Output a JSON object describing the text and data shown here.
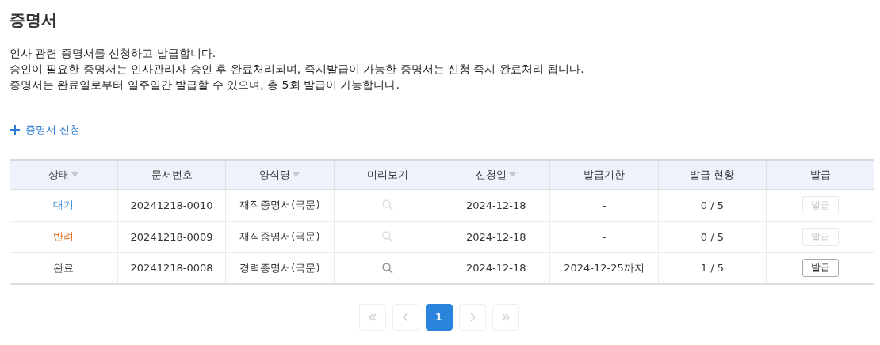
{
  "page_title": "증명서",
  "description": [
    "인사 관련 증명서를 신청하고 발급합니다.",
    "승인이 필요한 증명서는 인사관리자 승인 후 완료처리되며, 즉시발급이 가능한 증명서는 신청 즉시 완료처리 됩니다.",
    "증명서는 완료일로부터 일주일간 발급할 수 있으며, 총 5회 발급이 가능합니다."
  ],
  "request_link": {
    "label": "증명서 신청"
  },
  "table": {
    "columns": [
      {
        "label": "상태",
        "sortable": true
      },
      {
        "label": "문서번호",
        "sortable": false
      },
      {
        "label": "양식명",
        "sortable": true
      },
      {
        "label": "미리보기",
        "sortable": false
      },
      {
        "label": "신청일",
        "sortable": true
      },
      {
        "label": "발급기한",
        "sortable": false
      },
      {
        "label": "발급 현황",
        "sortable": false
      },
      {
        "label": "발급",
        "sortable": false
      }
    ],
    "rows": [
      {
        "status": "대기",
        "color": "#3d8fd9",
        "doc_no": "20241218-0010",
        "form": "재직증명서(국문)",
        "preview_enabled": false,
        "date": "2024-12-18",
        "deadline": "-",
        "count": "0 / 5",
        "issue": {
          "label": "발급",
          "disabled": true
        }
      },
      {
        "status": "반려",
        "color": "#e06b1f",
        "doc_no": "20241218-0009",
        "form": "재직증명서(국문)",
        "preview_enabled": false,
        "date": "2024-12-18",
        "deadline": "-",
        "count": "0 / 5",
        "issue": {
          "label": "발급",
          "disabled": true
        }
      },
      {
        "status": "완료",
        "color": "#333333",
        "doc_no": "20241218-0008",
        "form": "경력증명서(국문)",
        "preview_enabled": true,
        "date": "2024-12-18",
        "deadline": "2024-12-25까지",
        "count": "1 / 5",
        "issue": {
          "label": "발급",
          "disabled": false
        }
      }
    ]
  },
  "pagination": {
    "pages": [
      {
        "label": "1",
        "selected": true
      }
    ]
  }
}
